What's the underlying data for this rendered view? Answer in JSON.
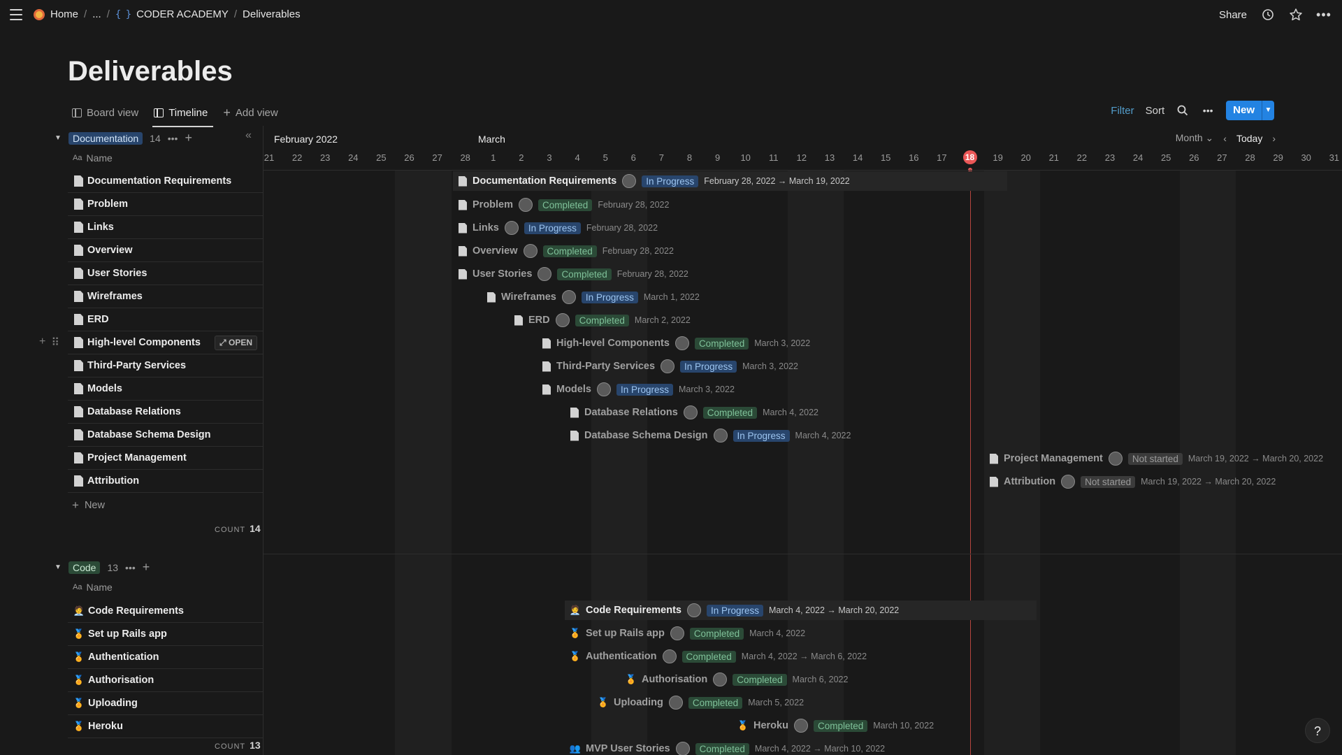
{
  "breadcrumb": {
    "home": "Home",
    "ellipsis": "...",
    "workspace": "CODER ACADEMY",
    "current": "Deliverables"
  },
  "topbar": {
    "share": "Share"
  },
  "page_title": "Deliverables",
  "views": {
    "board": "Board view",
    "timeline": "Timeline",
    "add": "Add view",
    "filter": "Filter",
    "sort": "Sort",
    "new": "New"
  },
  "timeline": {
    "month_left": "February 2022",
    "month_right": "March",
    "scale": "Month",
    "today_btn": "Today",
    "days": [
      "21",
      "22",
      "23",
      "24",
      "25",
      "26",
      "27",
      "28",
      "1",
      "2",
      "3",
      "4",
      "5",
      "6",
      "7",
      "8",
      "9",
      "10",
      "11",
      "12",
      "13",
      "14",
      "15",
      "16",
      "17",
      "18",
      "19",
      "20",
      "21",
      "22",
      "23",
      "24",
      "25",
      "26",
      "27",
      "28",
      "29",
      "30",
      "31"
    ],
    "today": "18"
  },
  "groups": {
    "documentation": {
      "tag": "Documentation",
      "count": "14",
      "name_header": "Name",
      "new_label": "New",
      "count_label": "COUNT",
      "count_value": "14",
      "open_label": "OPEN",
      "items": [
        {
          "name": "Documentation Requirements",
          "status": "In Progress",
          "date": "February 28, 2022 → March 19, 2022"
        },
        {
          "name": "Problem",
          "status": "Completed",
          "date": "February 28, 2022"
        },
        {
          "name": "Links",
          "status": "In Progress",
          "date": "February 28, 2022"
        },
        {
          "name": "Overview",
          "status": "Completed",
          "date": "February 28, 2022"
        },
        {
          "name": "User Stories",
          "status": "Completed",
          "date": "February 28, 2022"
        },
        {
          "name": "Wireframes",
          "status": "In Progress",
          "date": "March 1, 2022"
        },
        {
          "name": "ERD",
          "status": "Completed",
          "date": "March 2, 2022"
        },
        {
          "name": "High-level Components",
          "status": "Completed",
          "date": "March 3, 2022"
        },
        {
          "name": "Third-Party Services",
          "status": "In Progress",
          "date": "March 3, 2022"
        },
        {
          "name": "Models",
          "status": "In Progress",
          "date": "March 3, 2022"
        },
        {
          "name": "Database Relations",
          "status": "Completed",
          "date": "March 4, 2022"
        },
        {
          "name": "Database Schema Design",
          "status": "In Progress",
          "date": "March 4, 2022"
        },
        {
          "name": "Project Management",
          "status": "Not started",
          "date": "March 19, 2022 → March 20, 2022"
        },
        {
          "name": "Attribution",
          "status": "Not started",
          "date": "March 19, 2022 → March 20, 2022"
        }
      ]
    },
    "code": {
      "tag": "Code",
      "count": "13",
      "name_header": "Name",
      "count_label": "COUNT",
      "count_value": "13",
      "items": [
        {
          "name": "Code Requirements",
          "icon": "🧑‍💼",
          "status": "In Progress",
          "date": "March 4, 2022 → March 20, 2022"
        },
        {
          "name": "Set up Rails app",
          "icon": "🏅",
          "status": "Completed",
          "date": "March 4, 2022"
        },
        {
          "name": "Authentication",
          "icon": "🏅",
          "status": "Completed",
          "date": "March 4, 2022 → March 6, 2022"
        },
        {
          "name": "Authorisation",
          "icon": "🏅",
          "status": "Completed",
          "date": "March 6, 2022"
        },
        {
          "name": "Uploading",
          "icon": "🏅",
          "status": "Completed",
          "date": "March 5, 2022"
        },
        {
          "name": "Heroku",
          "icon": "🏅",
          "status": "Completed",
          "date": "March 10, 2022"
        },
        {
          "name": "MVP User Stories",
          "icon": "👥",
          "status": "Completed",
          "date": "March 4, 2022 → March 10, 2022"
        }
      ]
    }
  },
  "help": "?"
}
